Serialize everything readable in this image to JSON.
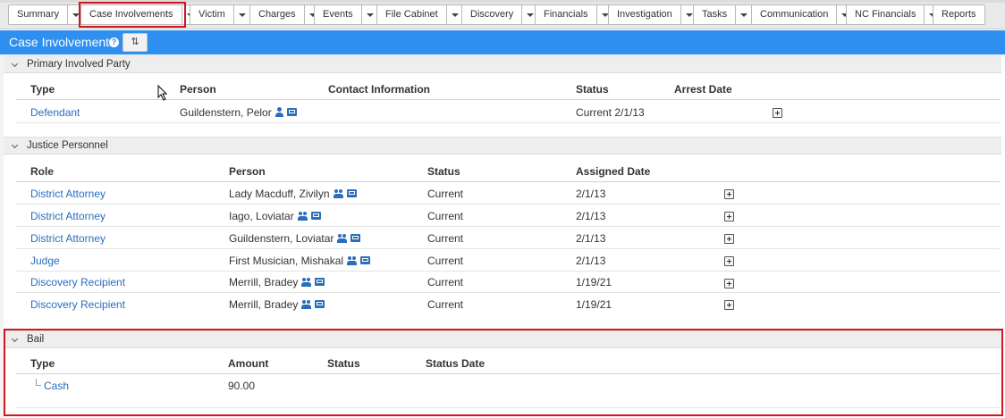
{
  "tabs": [
    {
      "label": "Summary",
      "has_menu": true
    },
    {
      "label": "Case Involvements",
      "has_menu": true
    },
    {
      "label": "Victim",
      "has_menu": true
    },
    {
      "label": "Charges",
      "has_menu": true
    },
    {
      "label": "Events",
      "has_menu": true
    },
    {
      "label": "File Cabinet",
      "has_menu": true
    },
    {
      "label": "Discovery",
      "has_menu": true
    },
    {
      "label": "Financials",
      "has_menu": true
    },
    {
      "label": "Investigation",
      "has_menu": true
    },
    {
      "label": "Tasks",
      "has_menu": true
    },
    {
      "label": "Communication",
      "has_menu": true
    },
    {
      "label": "NC Financials",
      "has_menu": true
    },
    {
      "label": "Reports",
      "has_menu": false
    }
  ],
  "header": {
    "title": "Case Involvements",
    "help_icon": "question-circle-icon",
    "refresh_label": "⇅"
  },
  "primary": {
    "title": "Primary Involved Party",
    "columns": [
      "Type",
      "Person",
      "Contact Information",
      "Status",
      "Arrest Date"
    ],
    "rows": [
      {
        "type": "Defendant",
        "person": "Guildenstern, Pelor",
        "contact": "",
        "status": "Current 2/1/13",
        "arrest_date": ""
      }
    ]
  },
  "justice": {
    "title": "Justice Personnel",
    "columns": [
      "Role",
      "Person",
      "Status",
      "Assigned Date"
    ],
    "rows": [
      {
        "role": "District Attorney",
        "person": "Lady Macduff, Zivilyn",
        "status": "Current",
        "assigned": "2/1/13"
      },
      {
        "role": "District Attorney",
        "person": "Iago, Loviatar",
        "status": "Current",
        "assigned": "2/1/13"
      },
      {
        "role": "District Attorney",
        "person": "Guildenstern, Loviatar",
        "status": "Current",
        "assigned": "2/1/13"
      },
      {
        "role": "Judge",
        "person": "First Musician, Mishakal",
        "status": "Current",
        "assigned": "2/1/13"
      },
      {
        "role": "Discovery Recipient",
        "person": "Merrill, Bradey",
        "status": "Current",
        "assigned": "1/19/21"
      },
      {
        "role": "Discovery Recipient",
        "person": "Merrill, Bradey",
        "status": "Current",
        "assigned": "1/19/21"
      }
    ]
  },
  "bail": {
    "title": "Bail",
    "columns": [
      "Type",
      "Amount",
      "Status",
      "Status Date"
    ],
    "rows": [
      {
        "type": "Cash",
        "amount": "90.00",
        "status": "",
        "status_date": ""
      }
    ]
  },
  "colors": {
    "accent_blue": "#2f8ff0",
    "link_blue": "#2a6ebb",
    "highlight_red": "#d0161e"
  }
}
